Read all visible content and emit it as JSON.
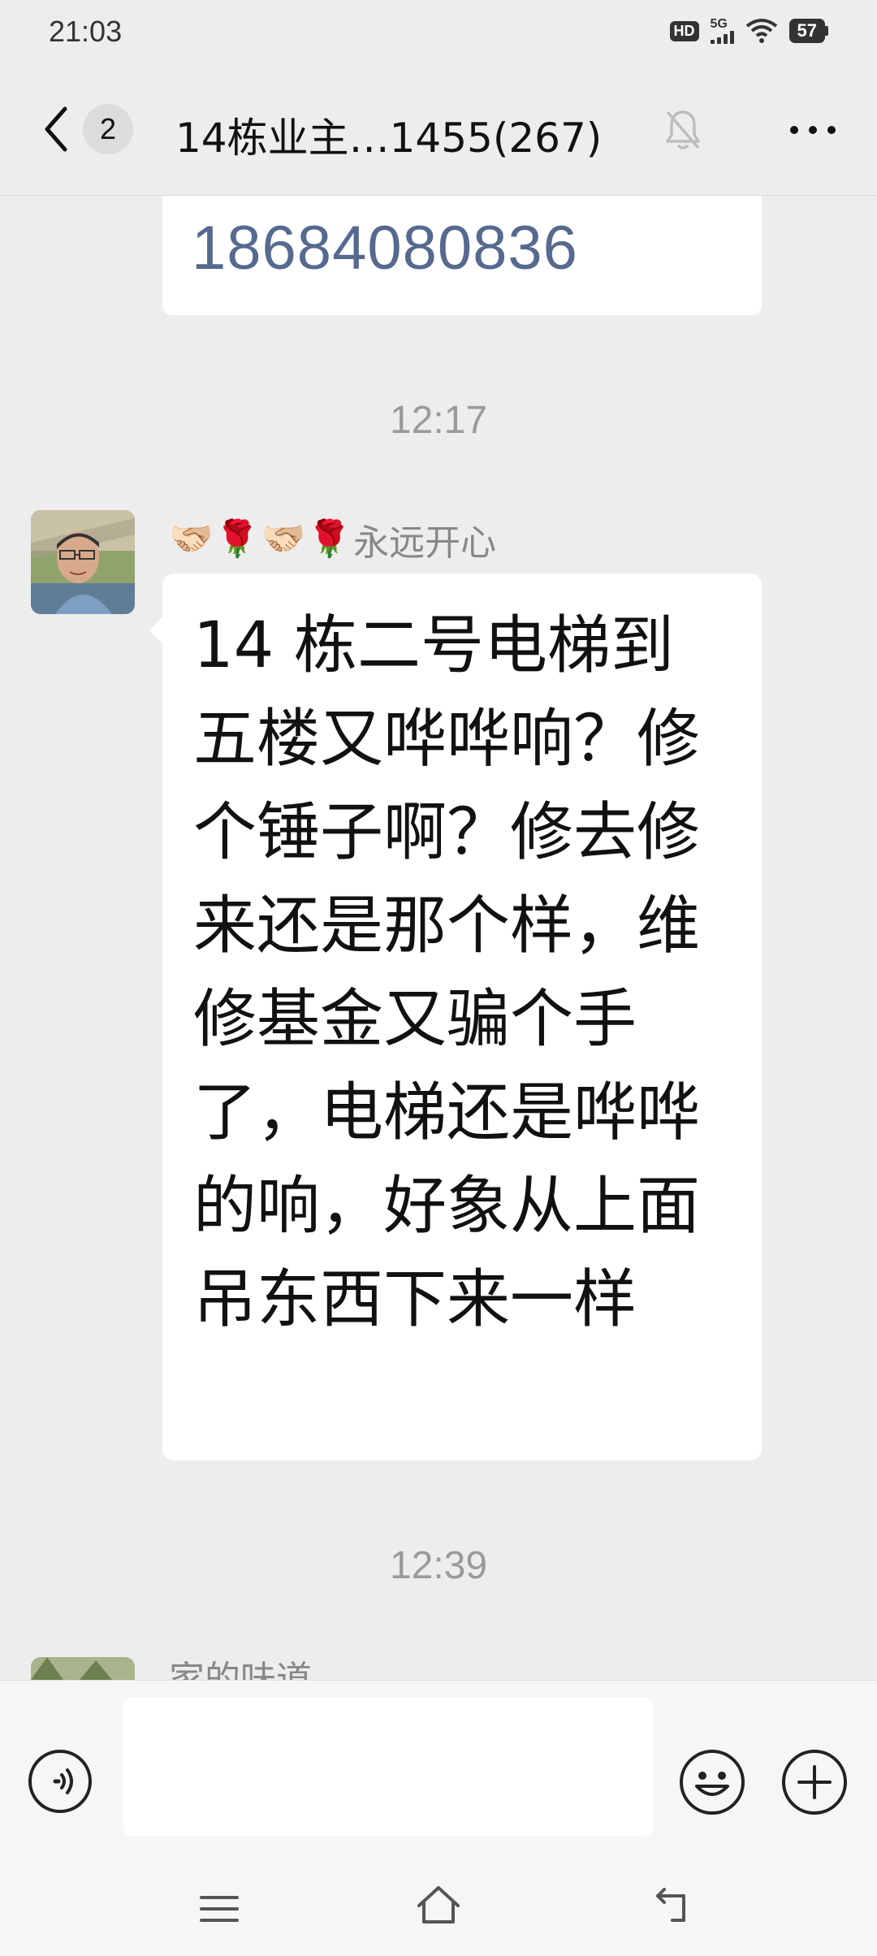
{
  "status_bar": {
    "time": "21:03",
    "hd_label": "HD",
    "network_label": "5G",
    "battery_level": "57"
  },
  "header": {
    "unread_count": "2",
    "title": "14栋业主…1455(267)",
    "back_icon": "chevron-left-icon",
    "mute_icon": "bell-off-icon",
    "more_icon": "more-dots-icon"
  },
  "messages": {
    "prev_bubble_text": "18684080836",
    "time_sep_1": "12:17",
    "sender_emojis": [
      "🫱🏻‍🫲🏼",
      "🌹",
      "🫱🏻‍🫲🏼",
      "🌹"
    ],
    "sender_name": "永远开心",
    "main_text": "14 栋二号电梯到五楼又哗哗响？修个锤子啊？修去修来还是那个样，维修基金又骗个手了，电梯还是哗哗的响，好象从上面吊东西下来一样",
    "time_sep_2": "12:39",
    "next_sender_partial": "家的味道"
  },
  "input_bar": {
    "message_value": "",
    "voice_icon": "voice-icon",
    "emoji_icon": "emoji-icon",
    "plus_icon": "plus-icon"
  },
  "system_nav": {
    "menu_icon": "menu-icon",
    "home_icon": "home-icon",
    "back_icon": "back-icon"
  }
}
